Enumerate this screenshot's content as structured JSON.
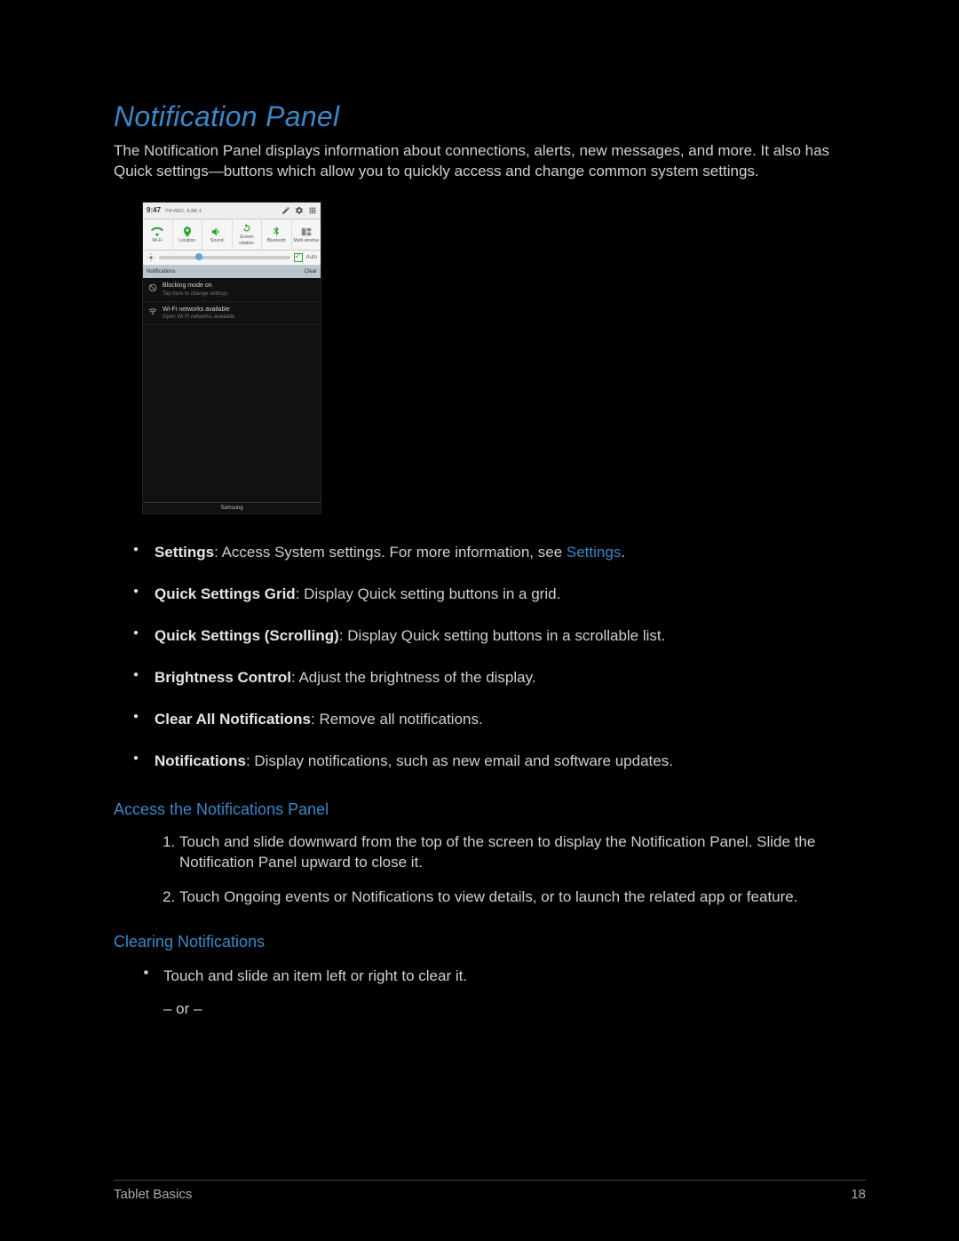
{
  "title": "Notification Panel",
  "intro": "The Notification Panel displays information about connections, alerts, new messages, and more. It also has Quick settings—buttons which allow you to quickly access and change common system settings.",
  "panel": {
    "clock": "9:47",
    "clock_suffix": "PM WED, JUNE 4",
    "quick_settings": [
      "Wi-Fi",
      "Location",
      "Sound",
      "Screen rotation",
      "Bluetooth",
      "Multi window"
    ],
    "auto_label": "Auto",
    "notif_header": "Notifications",
    "clear_label": "Clear",
    "notifs": [
      {
        "title": "Blocking mode on",
        "sub": "Tap here to change settings"
      },
      {
        "title": "Wi-Fi networks available",
        "sub": "Open Wi-Fi networks available"
      }
    ],
    "brand": "Samsung"
  },
  "bullets": [
    {
      "term": "Settings",
      "desc": ": Access System settings. For more information, see ",
      "link": "Settings",
      "tail": "."
    },
    {
      "term": "Quick Settings Grid",
      "desc": ": Display Quick setting buttons in a grid."
    },
    {
      "term": "Quick Settings (Scrolling)",
      "desc": ": Display Quick setting buttons in a scrollable list."
    },
    {
      "term": "Brightness Control",
      "desc": ": Adjust the brightness of the display."
    },
    {
      "term": "Clear All Notifications",
      "desc": ": Remove all notifications."
    },
    {
      "term": "Notifications",
      "desc": ": Display notifications, such as new email and software updates."
    }
  ],
  "sub1": "Access the Notifications Panel",
  "steps": [
    "Touch and slide downward from the top of the screen to display the Notification Panel. Slide the Notification Panel upward to close it.",
    "Touch Ongoing events or Notifications to view details, or to launch the related app or feature."
  ],
  "sub2": "Clearing Notifications",
  "clearing_item": "Touch and slide an item left or right to clear it.",
  "or_line": "– or –",
  "footer_left": "Tablet Basics",
  "footer_right": "18"
}
